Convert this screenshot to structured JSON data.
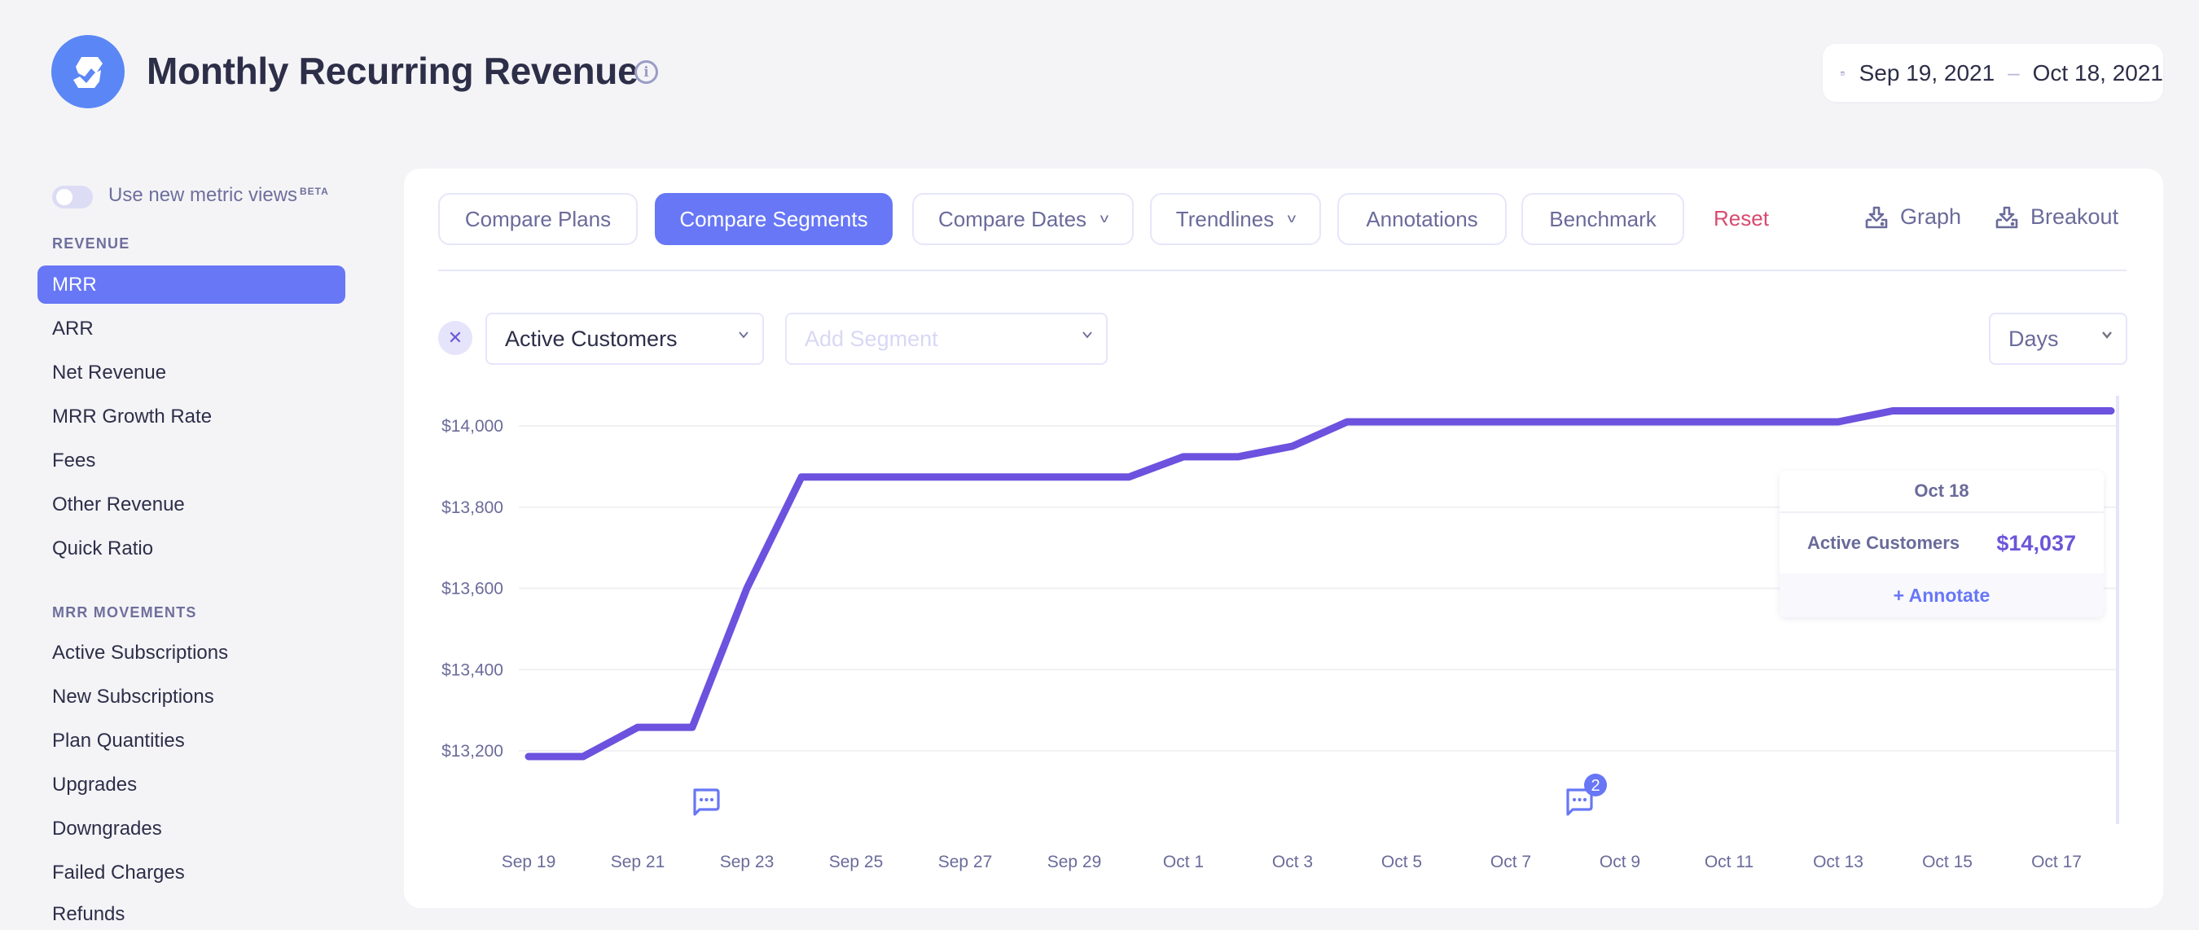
{
  "header": {
    "title": "Monthly Recurring Revenue",
    "date_start": "Sep 19, 2021",
    "date_separator": "–",
    "date_end": "Oct 18, 2021"
  },
  "sidebar": {
    "toggle_label": "Use new metric views",
    "toggle_badge": "BETA",
    "toggle_on": false,
    "sections": [
      {
        "label": "REVENUE",
        "items": [
          {
            "label": "MRR",
            "active": true
          },
          {
            "label": "ARR",
            "active": false
          },
          {
            "label": "Net Revenue",
            "active": false
          },
          {
            "label": "MRR Growth Rate",
            "active": false
          },
          {
            "label": "Fees",
            "active": false
          },
          {
            "label": "Other Revenue",
            "active": false
          },
          {
            "label": "Quick Ratio",
            "active": false
          }
        ]
      },
      {
        "label": "MRR MOVEMENTS",
        "items": [
          {
            "label": "Active Subscriptions",
            "active": false
          },
          {
            "label": "New Subscriptions",
            "active": false
          },
          {
            "label": "Plan Quantities",
            "active": false
          },
          {
            "label": "Upgrades",
            "active": false
          },
          {
            "label": "Downgrades",
            "active": false
          },
          {
            "label": "Failed Charges",
            "active": false
          },
          {
            "label": "Refunds",
            "active": false
          }
        ]
      }
    ]
  },
  "toolbar": {
    "compare_plans": "Compare Plans",
    "compare_segments": "Compare Segments",
    "compare_dates": "Compare Dates",
    "trendlines": "Trendlines",
    "annotations": "Annotations",
    "benchmark": "Benchmark",
    "reset": "Reset",
    "graph": "Graph",
    "breakout": "Breakout",
    "active": "compare_segments"
  },
  "segments": {
    "selected": "Active Customers",
    "add_placeholder": "Add Segment",
    "interval": "Days"
  },
  "tooltip": {
    "date": "Oct 18",
    "series": "Active Customers",
    "value": "$14,037",
    "annotate": "+ Annotate"
  },
  "colors": {
    "accent": "#6777f6",
    "line": "#6c52de",
    "reset": "#d84a6f",
    "logo": "#5b86f5"
  },
  "chart_data": {
    "type": "line",
    "title": "",
    "xlabel": "",
    "ylabel": "",
    "ylim": [
      13200,
      14000
    ],
    "yticks": [
      13200,
      13400,
      13600,
      13800,
      14000
    ],
    "ytick_labels": [
      "$13,200",
      "$13,400",
      "$13,600",
      "$13,800",
      "$14,000"
    ],
    "grid": true,
    "x": [
      "Sep 19",
      "Sep 20",
      "Sep 21",
      "Sep 22",
      "Sep 23",
      "Sep 24",
      "Sep 25",
      "Sep 26",
      "Sep 27",
      "Sep 28",
      "Sep 29",
      "Sep 30",
      "Oct 1",
      "Oct 2",
      "Oct 3",
      "Oct 4",
      "Oct 5",
      "Oct 6",
      "Oct 7",
      "Oct 8",
      "Oct 9",
      "Oct 10",
      "Oct 11",
      "Oct 12",
      "Oct 13",
      "Oct 14",
      "Oct 15",
      "Oct 16",
      "Oct 17",
      "Oct 18"
    ],
    "xtick_labels": [
      "Sep 19",
      "Sep 21",
      "Sep 23",
      "Sep 25",
      "Sep 27",
      "Sep 29",
      "Oct 1",
      "Oct 3",
      "Oct 5",
      "Oct 7",
      "Oct 9",
      "Oct 11",
      "Oct 13",
      "Oct 15",
      "Oct 17"
    ],
    "series": [
      {
        "name": "Active Customers",
        "values": [
          13186,
          13186,
          13258,
          13258,
          13600,
          13874,
          13874,
          13874,
          13874,
          13874,
          13874,
          13874,
          13924,
          13924,
          13950,
          14010,
          14010,
          14010,
          14010,
          14010,
          14010,
          14010,
          14010,
          14010,
          14010,
          14037,
          14037,
          14037,
          14037,
          14037
        ]
      }
    ],
    "annotations": [
      {
        "date": "Sep 22",
        "count": 1
      },
      {
        "date": "Oct 8",
        "count": 2
      }
    ],
    "hover_date": "Oct 18"
  }
}
